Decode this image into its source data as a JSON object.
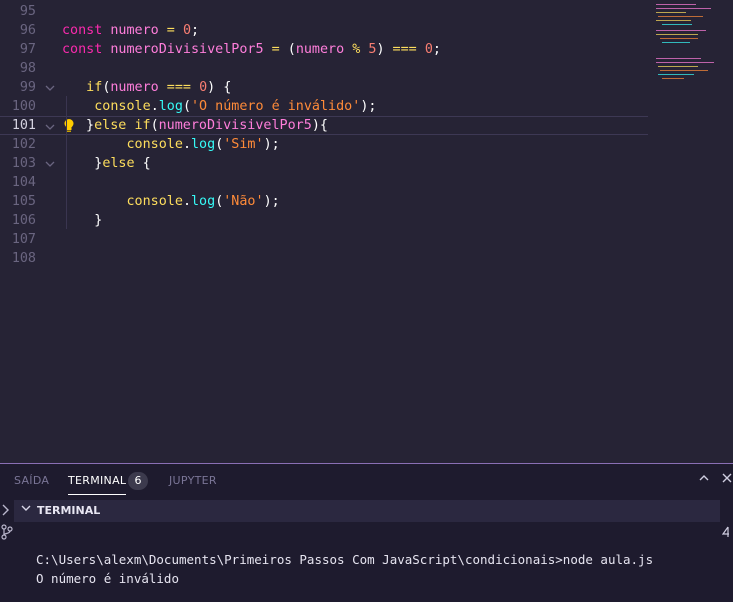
{
  "editor": {
    "active_line": "101",
    "lines": [
      {
        "num": "95",
        "tokens": []
      },
      {
        "num": "96",
        "tokens": [
          {
            "t": "const ",
            "c": "t-kwp"
          },
          {
            "t": "numero",
            "c": "t-var"
          },
          {
            "t": " = ",
            "c": "t-op"
          },
          {
            "t": "0",
            "c": "t-num"
          },
          {
            "t": ";",
            "c": "t-punc"
          }
        ]
      },
      {
        "num": "97",
        "tokens": [
          {
            "t": "const ",
            "c": "t-kwp"
          },
          {
            "t": "numeroDivisivelPor5",
            "c": "t-var"
          },
          {
            "t": " = ",
            "c": "t-op"
          },
          {
            "t": "(",
            "c": "t-punc"
          },
          {
            "t": "numero",
            "c": "t-var"
          },
          {
            "t": " % ",
            "c": "t-op"
          },
          {
            "t": "5",
            "c": "t-num"
          },
          {
            "t": ")",
            "c": "t-punc"
          },
          {
            "t": " === ",
            "c": "t-op"
          },
          {
            "t": "0",
            "c": "t-num"
          },
          {
            "t": ";",
            "c": "t-punc"
          }
        ]
      },
      {
        "num": "98",
        "tokens": []
      },
      {
        "num": "99",
        "fold": true,
        "tokens": [
          {
            "t": "   if",
            "c": "t-kw"
          },
          {
            "t": "(",
            "c": "t-punc"
          },
          {
            "t": "numero",
            "c": "t-var"
          },
          {
            "t": " === ",
            "c": "t-op"
          },
          {
            "t": "0",
            "c": "t-num"
          },
          {
            "t": ") {",
            "c": "t-punc"
          }
        ]
      },
      {
        "num": "100",
        "tokens": [
          {
            "t": "    console",
            "c": "t-obj"
          },
          {
            "t": ".",
            "c": "t-punc"
          },
          {
            "t": "log",
            "c": "t-fn"
          },
          {
            "t": "(",
            "c": "t-punc"
          },
          {
            "t": "'O número é inválido'",
            "c": "t-str"
          },
          {
            "t": ");",
            "c": "t-punc"
          }
        ]
      },
      {
        "num": "101",
        "fold": true,
        "bulb": true,
        "tokens": [
          {
            "t": "   }",
            "c": "t-punc"
          },
          {
            "t": "else ",
            "c": "t-kw"
          },
          {
            "t": "if",
            "c": "t-kw"
          },
          {
            "t": "(",
            "c": "t-punc"
          },
          {
            "t": "numeroDivisivelPor5",
            "c": "t-var"
          },
          {
            "t": "){",
            "c": "t-punc"
          }
        ]
      },
      {
        "num": "102",
        "tokens": [
          {
            "t": "        console",
            "c": "t-obj"
          },
          {
            "t": ".",
            "c": "t-punc"
          },
          {
            "t": "log",
            "c": "t-fn"
          },
          {
            "t": "(",
            "c": "t-punc"
          },
          {
            "t": "'Sim'",
            "c": "t-str"
          },
          {
            "t": ");",
            "c": "t-punc"
          }
        ]
      },
      {
        "num": "103",
        "fold": true,
        "tokens": [
          {
            "t": "    }",
            "c": "t-punc"
          },
          {
            "t": "else",
            "c": "t-kw"
          },
          {
            "t": " {",
            "c": "t-punc"
          }
        ]
      },
      {
        "num": "104",
        "tokens": []
      },
      {
        "num": "105",
        "tokens": [
          {
            "t": "        console",
            "c": "t-obj"
          },
          {
            "t": ".",
            "c": "t-punc"
          },
          {
            "t": "log",
            "c": "t-fn"
          },
          {
            "t": "(",
            "c": "t-punc"
          },
          {
            "t": "'Não'",
            "c": "t-str"
          },
          {
            "t": ");",
            "c": "t-punc"
          }
        ]
      },
      {
        "num": "106",
        "tokens": [
          {
            "t": "    }",
            "c": "t-punc"
          }
        ]
      },
      {
        "num": "107",
        "tokens": []
      },
      {
        "num": "108",
        "tokens": []
      }
    ]
  },
  "panel": {
    "tabs": [
      {
        "label": "SAÍDA",
        "active": false
      },
      {
        "label": "TERMINAL",
        "active": true
      },
      {
        "label": "JUPYTER",
        "active": false
      }
    ],
    "terminal_badge": "6",
    "section_title": "TERMINAL",
    "terminal_lines": [
      "C:\\Users\\alexm\\Documents\\Primeiros Passos Com JavaScript\\condicionais>node aula.js",
      "O número é inválido"
    ]
  },
  "icons": {
    "maximize": "chevron-up-icon",
    "close": "close-icon"
  },
  "colors": {
    "editor_bg": "#262335",
    "panel_bg": "#1e1b2e",
    "accent": "#8a6fb5"
  }
}
